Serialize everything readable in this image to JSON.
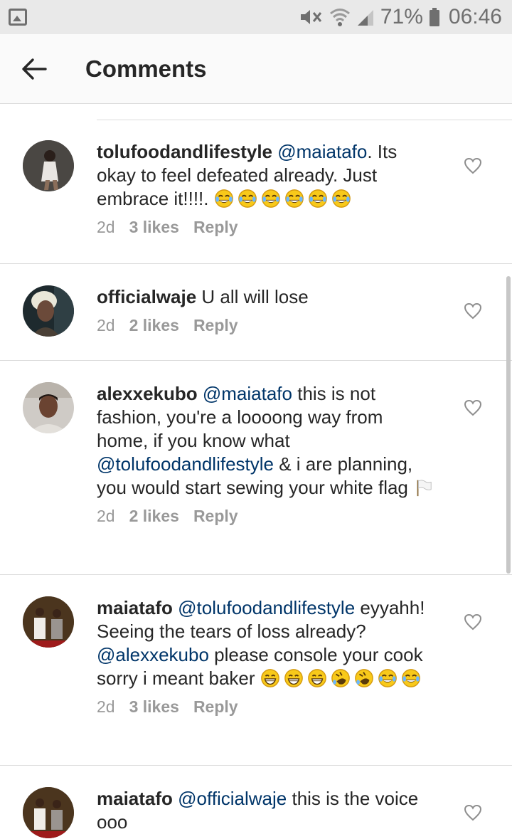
{
  "status_bar": {
    "battery": "71%",
    "time": "06:46",
    "icons": [
      "gallery-icon",
      "mute-icon",
      "wifi-icon",
      "signal-icon",
      "battery-icon"
    ]
  },
  "header": {
    "title": "Comments",
    "back_icon": "arrow-left-icon"
  },
  "comments": [
    {
      "username": "tolufoodandlifestyle",
      "parts": [
        "@maiatafo",
        ". Its okay to feel defeated already. Just embrace  it!!!!. "
      ],
      "emojis": [
        "tears-of-joy",
        "tears-of-joy",
        "tears-of-joy",
        "tears-of-joy",
        "tears-of-joy",
        "tears-of-joy"
      ],
      "time": "2d",
      "likes": "3 likes",
      "reply": "Reply"
    },
    {
      "username": "officialwaje",
      "parts": [
        "U all will lose"
      ],
      "time": "2d",
      "likes": "2 likes",
      "reply": "Reply"
    },
    {
      "username": "alexxekubo",
      "parts": [
        "@maiatafo",
        " this is not fashion, you're a loooong way from home, if you know what ",
        "@tolufoodandlifestyle",
        " & i are planning, you would start sewing your white flag "
      ],
      "emojis": [
        "white-flag"
      ],
      "time": "2d",
      "likes": "2 likes",
      "reply": "Reply"
    },
    {
      "username": "maiatafo",
      "parts": [
        "@tolufoodandlifestyle",
        " eyyahh! Seeing the tears of loss already? ",
        "@alexxekubo",
        " please console your cook sorry i meant baker "
      ],
      "emojis": [
        "grinning",
        "grinning",
        "grinning",
        "rofl",
        "rofl",
        "tears-of-joy",
        "tears-of-joy"
      ],
      "time": "2d",
      "likes": "3 likes",
      "reply": "Reply"
    },
    {
      "username": "maiatafo",
      "parts": [
        "@officialwaje",
        " this is the voice ooo"
      ],
      "time": "",
      "likes": "",
      "reply": ""
    }
  ]
}
